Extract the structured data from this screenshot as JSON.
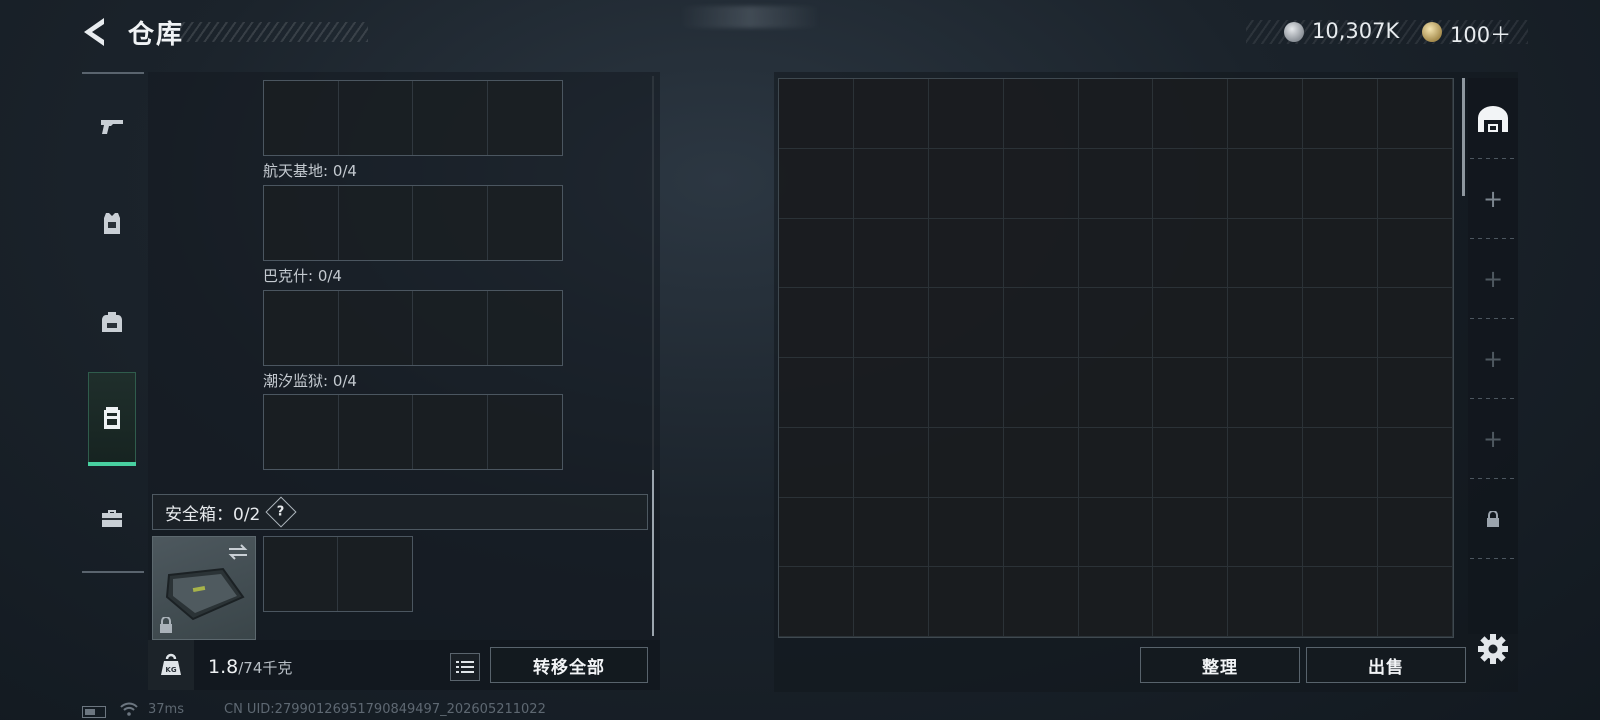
{
  "header": {
    "title": "仓库",
    "currency_silver": "10,307K",
    "currency_gold": "100＋"
  },
  "sidebar": {
    "items": [
      {
        "icon": "pistol-icon",
        "active": false
      },
      {
        "icon": "armor-vest-icon",
        "active": false
      },
      {
        "icon": "backpack-icon",
        "active": false
      },
      {
        "icon": "chest-rig-icon",
        "active": true
      },
      {
        "icon": "toolbox-icon",
        "active": false
      }
    ]
  },
  "left_panel": {
    "grids": [
      {
        "label": "航天基地: 0/4"
      },
      {
        "label": "巴克什: 0/4"
      },
      {
        "label": "潮汐监狱: 0/4"
      }
    ],
    "safebox": {
      "label": "安全箱：0/2",
      "help": "?"
    },
    "weight_current": "1.8",
    "weight_max": "/74千克",
    "transfer_all_label": "转移全部"
  },
  "right_panel": {
    "tidy_label": "整理",
    "sell_label": "出售"
  },
  "status_bar": {
    "ping": "37ms",
    "uid": "CN UID:27990126951790849497_202605211022"
  }
}
